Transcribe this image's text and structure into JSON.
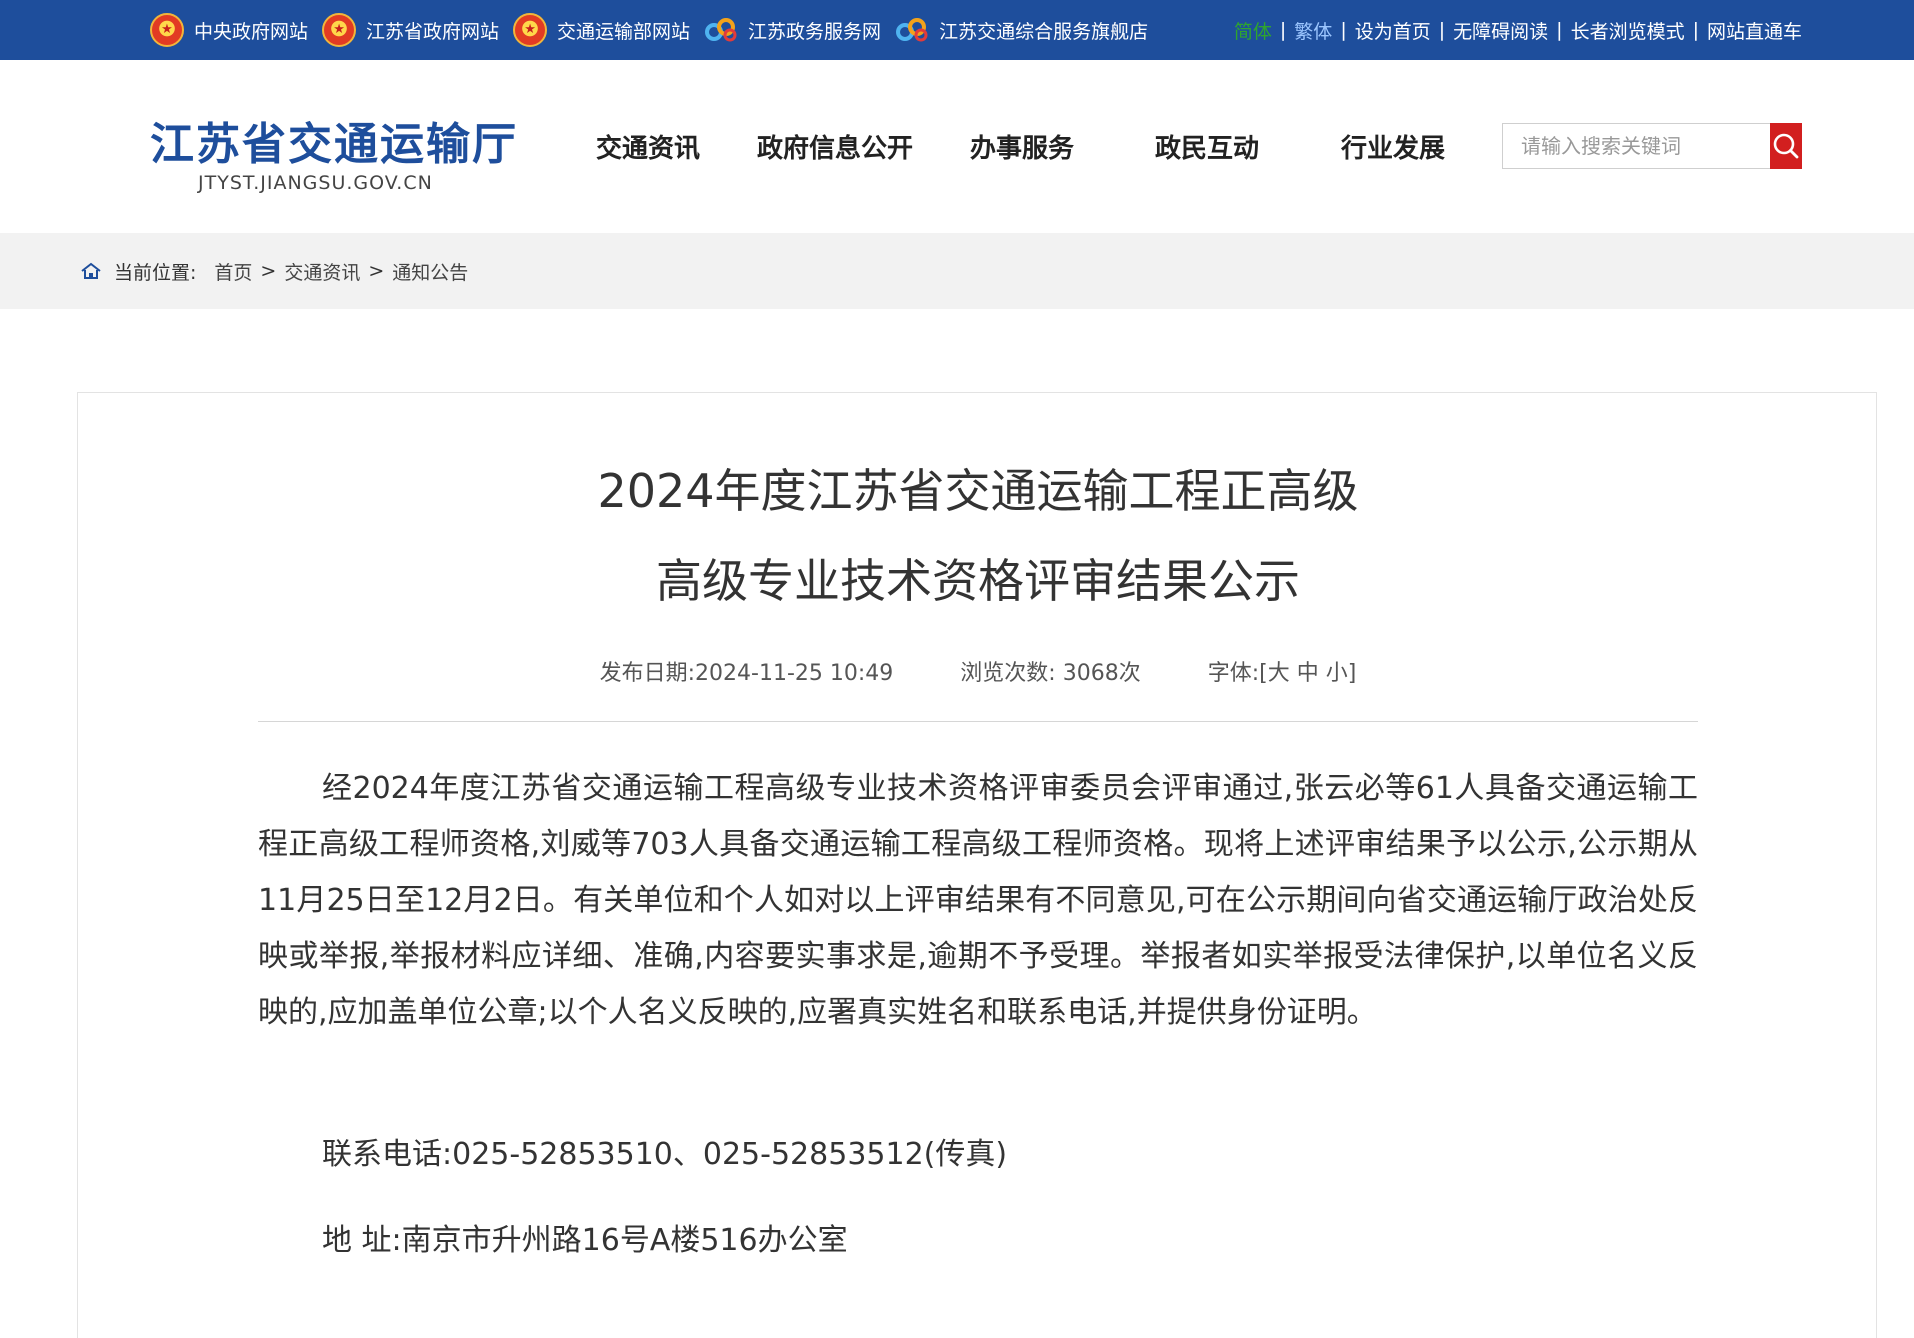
{
  "topbar": {
    "links": [
      {
        "label": "中央政府网站",
        "icon": "national-emblem-icon"
      },
      {
        "label": "江苏省政府网站",
        "icon": "national-emblem-icon"
      },
      {
        "label": "交通运输部网站",
        "icon": "national-emblem-icon"
      },
      {
        "label": "江苏政务服务网",
        "icon": "service-logo-icon"
      },
      {
        "label": "江苏交通综合服务旗舰店",
        "icon": "service-logo-icon"
      }
    ],
    "right": {
      "simplified": "简体",
      "traditional": "繁体",
      "homepage": "设为首页",
      "accessible": "无障碍阅读",
      "elder": "长者浏览模式",
      "directory": "网站直通车"
    },
    "colors": {
      "bar": "#1e4e9c",
      "simplified": "#2ea52e",
      "traditional": "#9cc6ff"
    }
  },
  "header": {
    "logo_title": "江苏省交通运输厅",
    "logo_sub": "JTYST.JIANGSU.GOV.CN",
    "nav": [
      "交通资讯",
      "政府信息公开",
      "办事服务",
      "政民互动",
      "行业发展"
    ],
    "search": {
      "placeholder": "请输入搜索关键词"
    },
    "colors": {
      "brand": "#1e4e9c",
      "search_button": "#d21f1f"
    }
  },
  "breadcrumb": {
    "label": "当前位置:",
    "items": [
      "首页",
      "交通资讯",
      "通知公告"
    ],
    "separator": ">"
  },
  "article": {
    "title_line1": "2024年度江苏省交通运输工程正高级",
    "title_line2": "高级专业技术资格评审结果公示",
    "meta": {
      "date_label": "发布日期:",
      "date": "2024-11-25 10:49",
      "views_label": "浏览次数:",
      "views": "3068次",
      "font_label": "字体:",
      "font_open": "[",
      "font_large": "大",
      "font_medium": "中",
      "font_small": "小",
      "font_close": "]"
    },
    "paragraph": "经2024年度江苏省交通运输工程高级专业技术资格评审委员会评审通过,张云必等61人具备交通运输工程正高级工程师资格,刘威等703人具备交通运输工程高级工程师资格。现将上述评审结果予以公示,公示期从11月25日至12月2日。有关单位和个人如对以上评审结果有不同意见,可在公示期间向省交通运输厅政治处反映或举报,举报材料应详细、准确,内容要实事求是,逾期不予受理。举报者如实举报受法律保护,以单位名义反映的,应加盖单位公章;以个人名义反映的,应署真实姓名和联系电话,并提供身份证明。",
    "phone": "联系电话:025-52853510、025-52853512(传真)",
    "address": "地 址:南京市升州路16号A楼516办公室"
  }
}
